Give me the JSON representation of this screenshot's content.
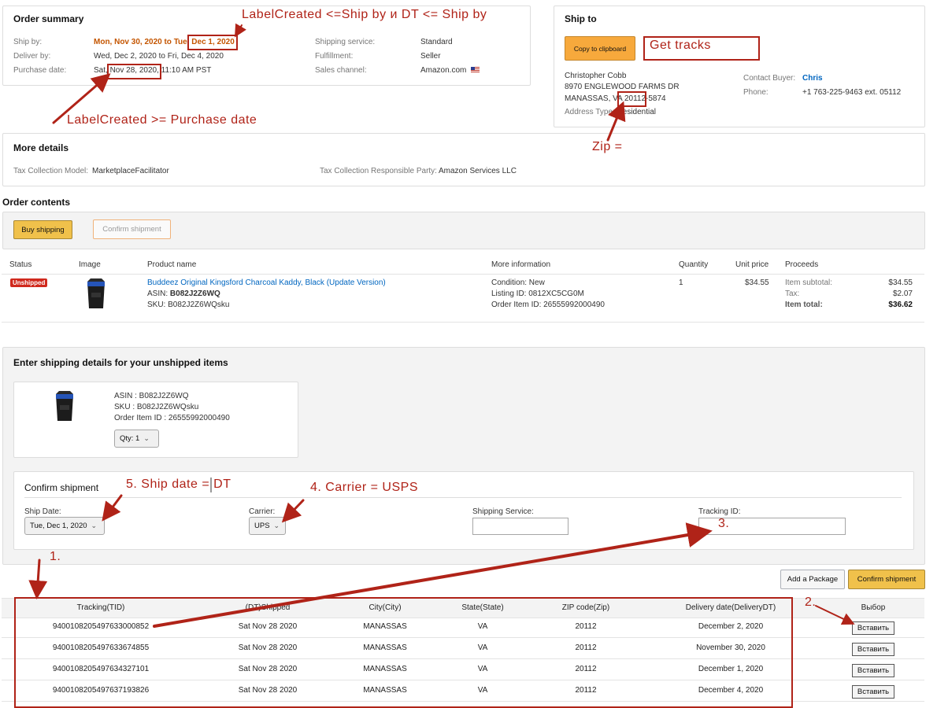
{
  "order_summary": {
    "title": "Order summary",
    "ship_by_label": "Ship by:",
    "ship_by_value_a": "Mon, Nov 30, 2020 to Tue, ",
    "ship_by_value_b": "Dec 1, 2020",
    "deliver_by_label": "Deliver by:",
    "deliver_by_value": "Wed, Dec 2, 2020 to Fri, Dec 4, 2020",
    "purchase_label": "Purchase date:",
    "purchase_value_a": "Sat, ",
    "purchase_value_b": "Nov 28, 2020,",
    "purchase_value_c": " 11:10 AM PST",
    "service_label": "Shipping service:",
    "service_value": "Standard",
    "fulfillment_label": "Fulfillment:",
    "fulfillment_value": "Seller",
    "channel_label": "Sales channel:",
    "channel_value": "Amazon.com"
  },
  "ship_to": {
    "title": "Ship to",
    "copy_button": "Copy to clipboard",
    "name": "Christopher Cobb",
    "address1": "8970 ENGLEWOOD FARMS DR",
    "city_a": "MANASSAS, VA ",
    "zip_a": "20112",
    "zip_b": "-5874",
    "address_type_label": "Address Type: ",
    "address_type_value": "Residential",
    "contact_label": "Contact Buyer:",
    "contact_value": "Chris",
    "phone_label": "Phone:",
    "phone_value": "+1 763-225-9463 ext. 05112"
  },
  "more_details": {
    "title": "More details",
    "tax_model_label": "Tax Collection Model:",
    "tax_model_value": "MarketplaceFacilitator",
    "tax_party_label": "Tax Collection Responsible Party:",
    "tax_party_value": "Amazon Services LLC"
  },
  "order_contents": {
    "title": "Order contents",
    "buy_shipping": "Buy shipping",
    "confirm_shipment": "Confirm shipment",
    "columns": [
      "Status",
      "Image",
      "Product name",
      "More information",
      "Quantity",
      "Unit price",
      "Proceeds"
    ],
    "status": "Unshipped",
    "product_name": "Buddeez Original Kingsford Charcoal Kaddy, Black (Update Version)",
    "asin_label": "ASIN: ",
    "asin_value": "B082J2Z6WQ",
    "sku": "SKU: B082J2Z6WQsku",
    "condition": "Condition: New",
    "listing_id": "Listing ID: 0812XC5CG0M",
    "order_item_id": "Order Item ID: 26555992000490",
    "quantity": "1",
    "unit_price": "$34.55",
    "item_subtotal_label": "Item subtotal:",
    "item_subtotal_value": "$34.55",
    "tax_label": "Tax:",
    "tax_value": "$2.07",
    "item_total_label": "Item total:",
    "item_total_value": "$36.62"
  },
  "shipping_details": {
    "title": "Enter shipping details for your unshipped items",
    "asin": "ASIN : B082J2Z6WQ",
    "sku": "SKU : B082J2Z6WQsku",
    "order_item": "Order Item ID : 26555992000490",
    "qty": "Qty: 1",
    "confirm_title": "Confirm shipment",
    "ship_date_label": "Ship Date:",
    "ship_date_value": "Tue, Dec 1, 2020",
    "carrier_label": "Carrier:",
    "carrier_value": "UPS",
    "service_label": "Shipping Service:",
    "service_value": "",
    "tracking_label": "Tracking ID:",
    "tracking_value": "",
    "add_package": "Add a Package",
    "confirm_button": "Confirm shipment"
  },
  "tracks": {
    "columns": [
      "Tracking(TID)",
      "(DT)Shipped",
      "City(City)",
      "State(State)",
      "ZIP code(Zip)",
      "Delivery date(DeliveryDT)",
      "Выбор"
    ],
    "insert_label": "Вставить",
    "rows": [
      {
        "tid": "9400108205497633000852",
        "shipped": "Sat Nov 28 2020",
        "city": "MANASSAS",
        "state": "VA",
        "zip": "20112",
        "delivery": "December 2, 2020"
      },
      {
        "tid": "9400108205497633674855",
        "shipped": "Sat Nov 28 2020",
        "city": "MANASSAS",
        "state": "VA",
        "zip": "20112",
        "delivery": "November 30, 2020"
      },
      {
        "tid": "9400108205497634327101",
        "shipped": "Sat Nov 28 2020",
        "city": "MANASSAS",
        "state": "VA",
        "zip": "20112",
        "delivery": "December 1, 2020"
      },
      {
        "tid": "9400108205497637193826",
        "shipped": "Sat Nov 28 2020",
        "city": "MANASSAS",
        "state": "VA",
        "zip": "20112",
        "delivery": "December 4, 2020"
      }
    ]
  },
  "annotations": {
    "label_created_ship_by": "LabelCreated <=Ship by и DT <= Ship by",
    "label_created_purchase": "LabelCreated >= Purchase date",
    "get_tracks": "Get tracks",
    "zip": "Zip =",
    "ship_date": "5. Ship date = DT",
    "carrier": "4. Carrier = USPS",
    "step3": "3.",
    "step1": "1.",
    "step2": "2."
  },
  "colors": {
    "annotation_red": "#b02318",
    "accent_orange": "#c45500",
    "button_yellow": "#f0c14b",
    "link_blue": "#0066c0",
    "status_red": "#d0291d"
  }
}
